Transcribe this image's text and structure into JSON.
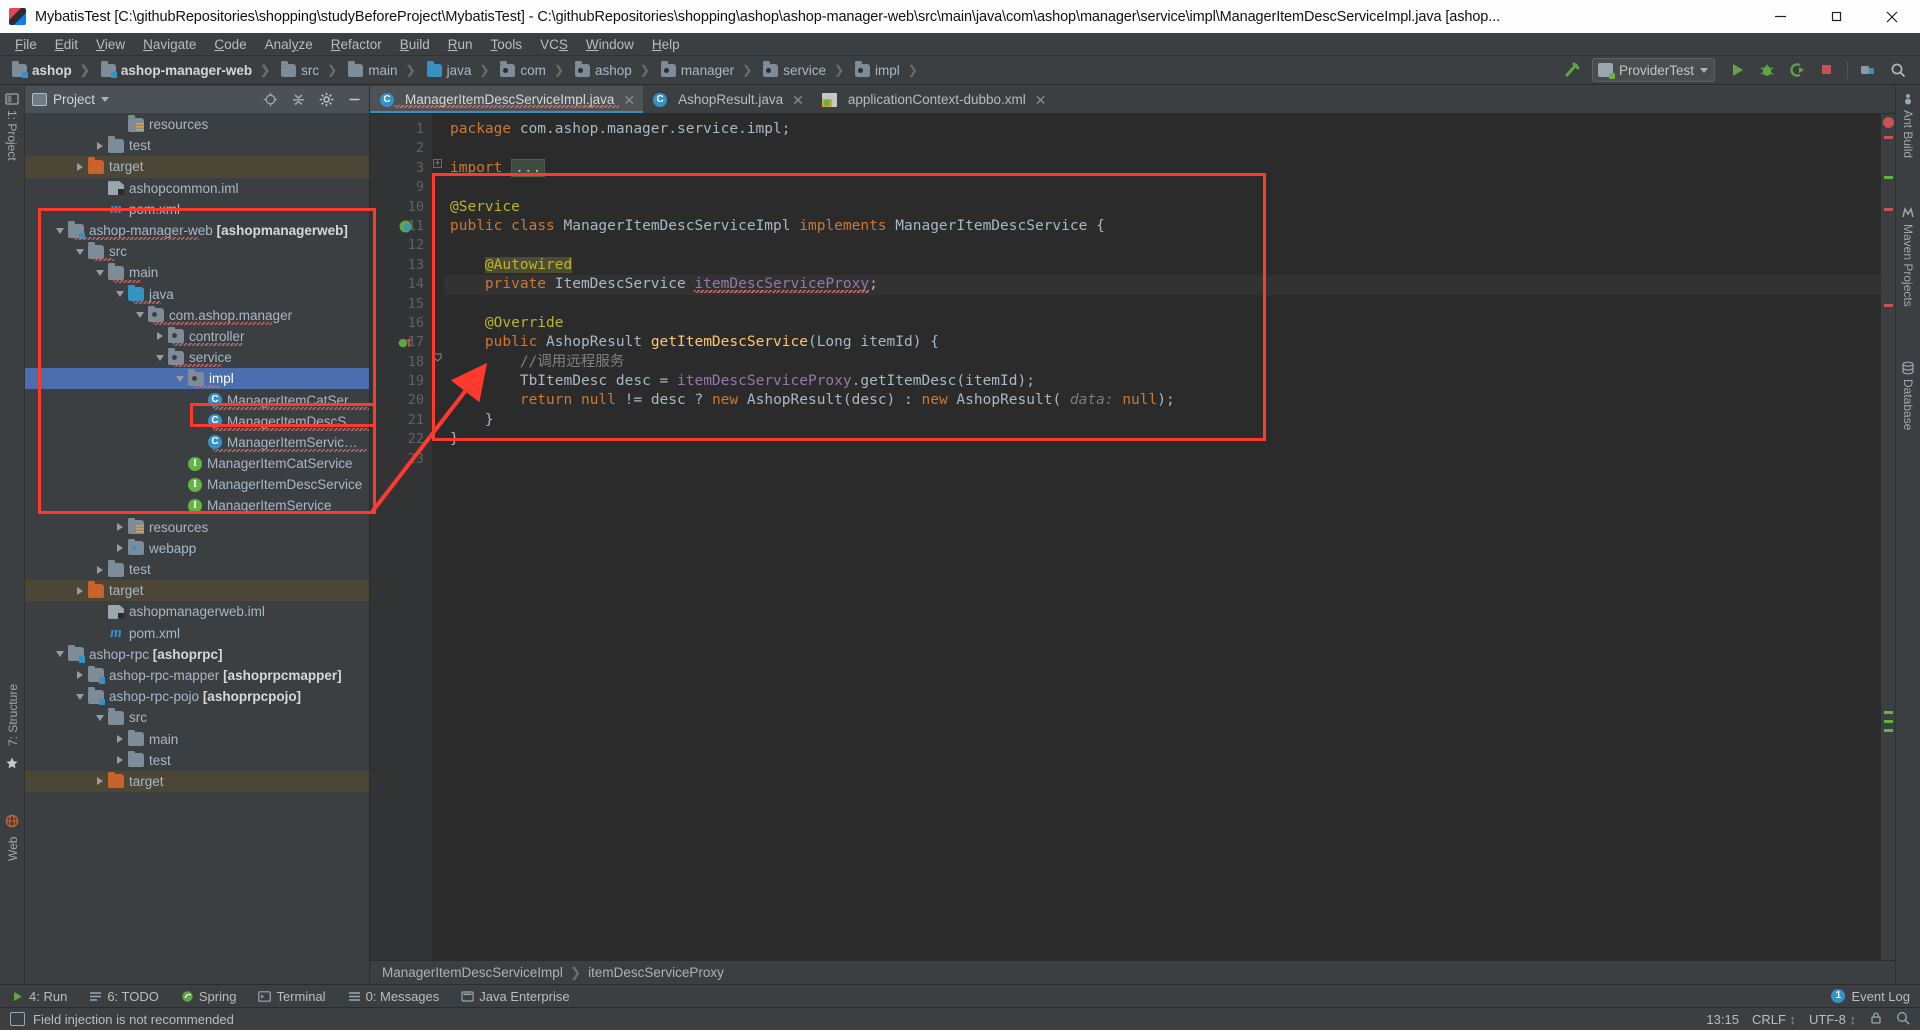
{
  "window": {
    "title": "MybatisTest [C:\\githubRepositories\\shopping\\studyBeforeProject\\MybatisTest] - C:\\githubRepositories\\shopping\\ashop\\ashop-manager-web\\src\\main\\java\\com\\ashop\\manager\\service\\impl\\ManagerItemDescServiceImpl.java [ashop...",
    "app_icon": "intellij-idea-icon",
    "minimize": "minimize-button",
    "maximize": "maximize-button",
    "close": "close-button"
  },
  "menubar": {
    "items": [
      {
        "label": "File"
      },
      {
        "label": "Edit"
      },
      {
        "label": "View"
      },
      {
        "label": "Navigate"
      },
      {
        "label": "Code"
      },
      {
        "label": "Analyze"
      },
      {
        "label": "Refactor"
      },
      {
        "label": "Build"
      },
      {
        "label": "Run"
      },
      {
        "label": "Tools"
      },
      {
        "label": "VCS"
      },
      {
        "label": "Window"
      },
      {
        "label": "Help"
      }
    ]
  },
  "navbar": {
    "breadcrumbs": [
      {
        "label": "ashop",
        "icon": "module-folder-icon",
        "bold": true
      },
      {
        "label": "ashop-manager-web",
        "icon": "module-folder-icon",
        "bold": true
      },
      {
        "label": "src",
        "icon": "folder-icon",
        "bold": false
      },
      {
        "label": "main",
        "icon": "folder-icon",
        "bold": false
      },
      {
        "label": "java",
        "icon": "source-folder-icon",
        "bold": false
      },
      {
        "label": "com",
        "icon": "package-icon",
        "bold": false
      },
      {
        "label": "ashop",
        "icon": "package-icon",
        "bold": false
      },
      {
        "label": "manager",
        "icon": "package-icon",
        "bold": false
      },
      {
        "label": "service",
        "icon": "package-icon",
        "bold": false
      },
      {
        "label": "impl",
        "icon": "package-icon",
        "bold": false
      }
    ],
    "run_configuration": "ProviderTest",
    "buttons": [
      {
        "name": "build-hammer-icon"
      },
      {
        "name": "run-button"
      },
      {
        "name": "debug-button"
      },
      {
        "name": "run-with-coverage-button"
      },
      {
        "name": "stop-button"
      },
      {
        "name": "open-project-structure-button"
      },
      {
        "name": "search-everywhere-button"
      }
    ]
  },
  "left_strip": {
    "project_label": "1: Project",
    "structure_label": "7: Structure",
    "favorites_label": "2: Favorites",
    "web_label": "Web"
  },
  "right_strip": {
    "ant_label": "Ant Build",
    "maven_label": "Maven Projects",
    "database_label": "Database"
  },
  "project_panel": {
    "title": "Project",
    "toolbar_buttons": [
      {
        "name": "locate-target-icon"
      },
      {
        "name": "collapse-all-icon"
      },
      {
        "name": "settings-gear-icon"
      },
      {
        "name": "hide-panel-icon"
      }
    ],
    "tree": [
      {
        "label": "resources",
        "indent": 4,
        "icon": "resources-folder-icon",
        "arrow": "none",
        "state": "normal"
      },
      {
        "label": "test",
        "indent": 3,
        "icon": "folder-icon",
        "arrow": "right",
        "state": "normal"
      },
      {
        "label": "target",
        "indent": 2,
        "icon": "target-folder-icon",
        "arrow": "right",
        "state": "target"
      },
      {
        "label": "ashopcommon.iml",
        "indent": 3,
        "icon": "iml-file-icon",
        "arrow": "none",
        "state": "normal"
      },
      {
        "label": "pom.xml",
        "indent": 3,
        "icon": "maven-pom-icon",
        "arrow": "none",
        "state": "normal"
      },
      {
        "label": "ashop-manager-web ",
        "bold": "[ashopmanagerweb]",
        "indent": 1,
        "icon": "module-folder-icon",
        "arrow": "down",
        "state": "normal",
        "squiggle": true
      },
      {
        "label": "src",
        "indent": 2,
        "icon": "folder-icon",
        "arrow": "down",
        "state": "normal",
        "squiggle": true
      },
      {
        "label": "main",
        "indent": 3,
        "icon": "folder-icon",
        "arrow": "down",
        "state": "normal",
        "squiggle": true
      },
      {
        "label": "java",
        "indent": 4,
        "icon": "source-folder-icon",
        "arrow": "down",
        "state": "normal",
        "squiggle": true
      },
      {
        "label": "com.ashop.manager",
        "indent": 5,
        "icon": "package-icon",
        "arrow": "down",
        "state": "normal",
        "squiggle": true
      },
      {
        "label": "controller",
        "indent": 6,
        "icon": "package-icon",
        "arrow": "right",
        "state": "normal",
        "squiggle": true
      },
      {
        "label": "service",
        "indent": 6,
        "icon": "package-icon",
        "arrow": "down",
        "state": "normal",
        "squiggle": true
      },
      {
        "label": "impl",
        "indent": 7,
        "icon": "package-icon",
        "arrow": "down",
        "state": "selected",
        "squiggle": true
      },
      {
        "label": "ManagerItemCatServiceImpl",
        "indent": 8,
        "icon": "java-class-icon",
        "arrow": "none",
        "state": "normal",
        "squiggle": true
      },
      {
        "label": "ManagerItemDescServiceImpl",
        "indent": 8,
        "icon": "java-class-icon",
        "arrow": "none",
        "state": "normal",
        "squiggle": true
      },
      {
        "label": "ManagerItemServiceImpl",
        "indent": 8,
        "icon": "java-class-icon",
        "arrow": "none",
        "state": "normal",
        "squiggle": true
      },
      {
        "label": "ManagerItemCatService",
        "indent": 7,
        "icon": "java-interface-icon",
        "arrow": "none",
        "state": "normal"
      },
      {
        "label": "ManagerItemDescService",
        "indent": 7,
        "icon": "java-interface-icon",
        "arrow": "none",
        "state": "normal"
      },
      {
        "label": "ManagerItemService",
        "indent": 7,
        "icon": "java-interface-icon",
        "arrow": "none",
        "state": "normal"
      },
      {
        "label": "resources",
        "indent": 4,
        "icon": "resources-folder-icon",
        "arrow": "right",
        "state": "normal"
      },
      {
        "label": "webapp",
        "indent": 4,
        "icon": "webapp-folder-icon",
        "arrow": "right",
        "state": "normal"
      },
      {
        "label": "test",
        "indent": 3,
        "icon": "folder-icon",
        "arrow": "right",
        "state": "normal"
      },
      {
        "label": "target",
        "indent": 2,
        "icon": "target-folder-icon",
        "arrow": "right",
        "state": "target"
      },
      {
        "label": "ashopmanagerweb.iml",
        "indent": 3,
        "icon": "iml-file-icon",
        "arrow": "none",
        "state": "normal"
      },
      {
        "label": "pom.xml",
        "indent": 3,
        "icon": "maven-pom-icon",
        "arrow": "none",
        "state": "normal"
      },
      {
        "label": "ashop-rpc ",
        "bold": "[ashoprpc]",
        "indent": 1,
        "icon": "module-folder-icon",
        "arrow": "down",
        "state": "normal"
      },
      {
        "label": "ashop-rpc-mapper ",
        "bold": "[ashoprpcmapper]",
        "indent": 2,
        "icon": "module-folder-icon",
        "arrow": "right",
        "state": "normal"
      },
      {
        "label": "ashop-rpc-pojo ",
        "bold": "[ashoprpcpojo]",
        "indent": 2,
        "icon": "module-folder-icon",
        "arrow": "down",
        "state": "normal"
      },
      {
        "label": "src",
        "indent": 3,
        "icon": "folder-icon",
        "arrow": "down",
        "state": "normal"
      },
      {
        "label": "main",
        "indent": 4,
        "icon": "folder-icon",
        "arrow": "right",
        "state": "normal"
      },
      {
        "label": "test",
        "indent": 4,
        "icon": "folder-icon",
        "arrow": "right",
        "state": "normal"
      },
      {
        "label": "target",
        "indent": 3,
        "icon": "target-folder-icon",
        "arrow": "right",
        "state": "target"
      }
    ]
  },
  "editor": {
    "tabs": [
      {
        "label": "ManagerItemDescServiceImpl.java",
        "icon": "java-class-icon",
        "active": true,
        "error": true
      },
      {
        "label": "AshopResult.java",
        "icon": "java-class-icon",
        "active": false,
        "error": false
      },
      {
        "label": "applicationContext-dubbo.xml",
        "icon": "spring-xml-icon",
        "active": false,
        "error": false
      }
    ],
    "line_numbers": [
      "1",
      "2",
      "3",
      "9",
      "10",
      "11",
      "12",
      "13",
      "14",
      "15",
      "16",
      "17",
      "18",
      "19",
      "20",
      "21",
      "22",
      "23"
    ],
    "code_lines": [
      "package com.ashop.manager.service.impl;",
      "",
      "import ...",
      "",
      "@Service",
      "public class ManagerItemDescServiceImpl implements ManagerItemDescService {",
      "",
      "    @Autowired",
      "    private ItemDescService itemDescServiceProxy;",
      "",
      "    @Override",
      "    public AshopResult getItemDescService(Long itemId) {",
      "        //调用远程服务",
      "        TbItemDesc desc = itemDescServiceProxy.getItemDesc(itemId);",
      "        return null != desc ? new AshopResult(desc) : new AshopResult( data: null);",
      "    }",
      "}",
      ""
    ],
    "param_hint": "data:",
    "gutter_marks": [
      {
        "line_index": 5,
        "name": "spring-bean-gutter-icon"
      },
      {
        "line_index": 11,
        "name": "implementing-method-gutter-icon"
      }
    ],
    "breadcrumb_bottom": [
      {
        "label": "ManagerItemDescServiceImpl"
      },
      {
        "label": "itemDescServiceProxy"
      }
    ]
  },
  "toolwindow_bar": {
    "items": [
      {
        "label": "4: Run",
        "icon": "run-icon"
      },
      {
        "label": "6: TODO",
        "icon": "todo-icon"
      },
      {
        "label": "Spring",
        "icon": "spring-icon"
      },
      {
        "label": "Terminal",
        "icon": "terminal-icon"
      },
      {
        "label": "0: Messages",
        "icon": "messages-icon"
      },
      {
        "label": "Java Enterprise",
        "icon": "java-enterprise-icon"
      }
    ],
    "event_log": "Event Log",
    "event_log_count": "1"
  },
  "statusbar": {
    "message": "Field injection is not recommended",
    "time": "13:15",
    "line_separator": "CRLF",
    "encoding": "UTF-8",
    "lock_icon": "lock-icon",
    "inspection_icon": "inspection-icon"
  },
  "annotations": {
    "box_color": "#fd3a2d",
    "arrow": "red-arrow-pointer"
  },
  "colors": {
    "accent": "#3592c4",
    "selection": "#4b6eaf",
    "panel_bg": "#3c3f41",
    "editor_bg": "#2b2b2b",
    "annotation_red": "#fd3a2d"
  }
}
